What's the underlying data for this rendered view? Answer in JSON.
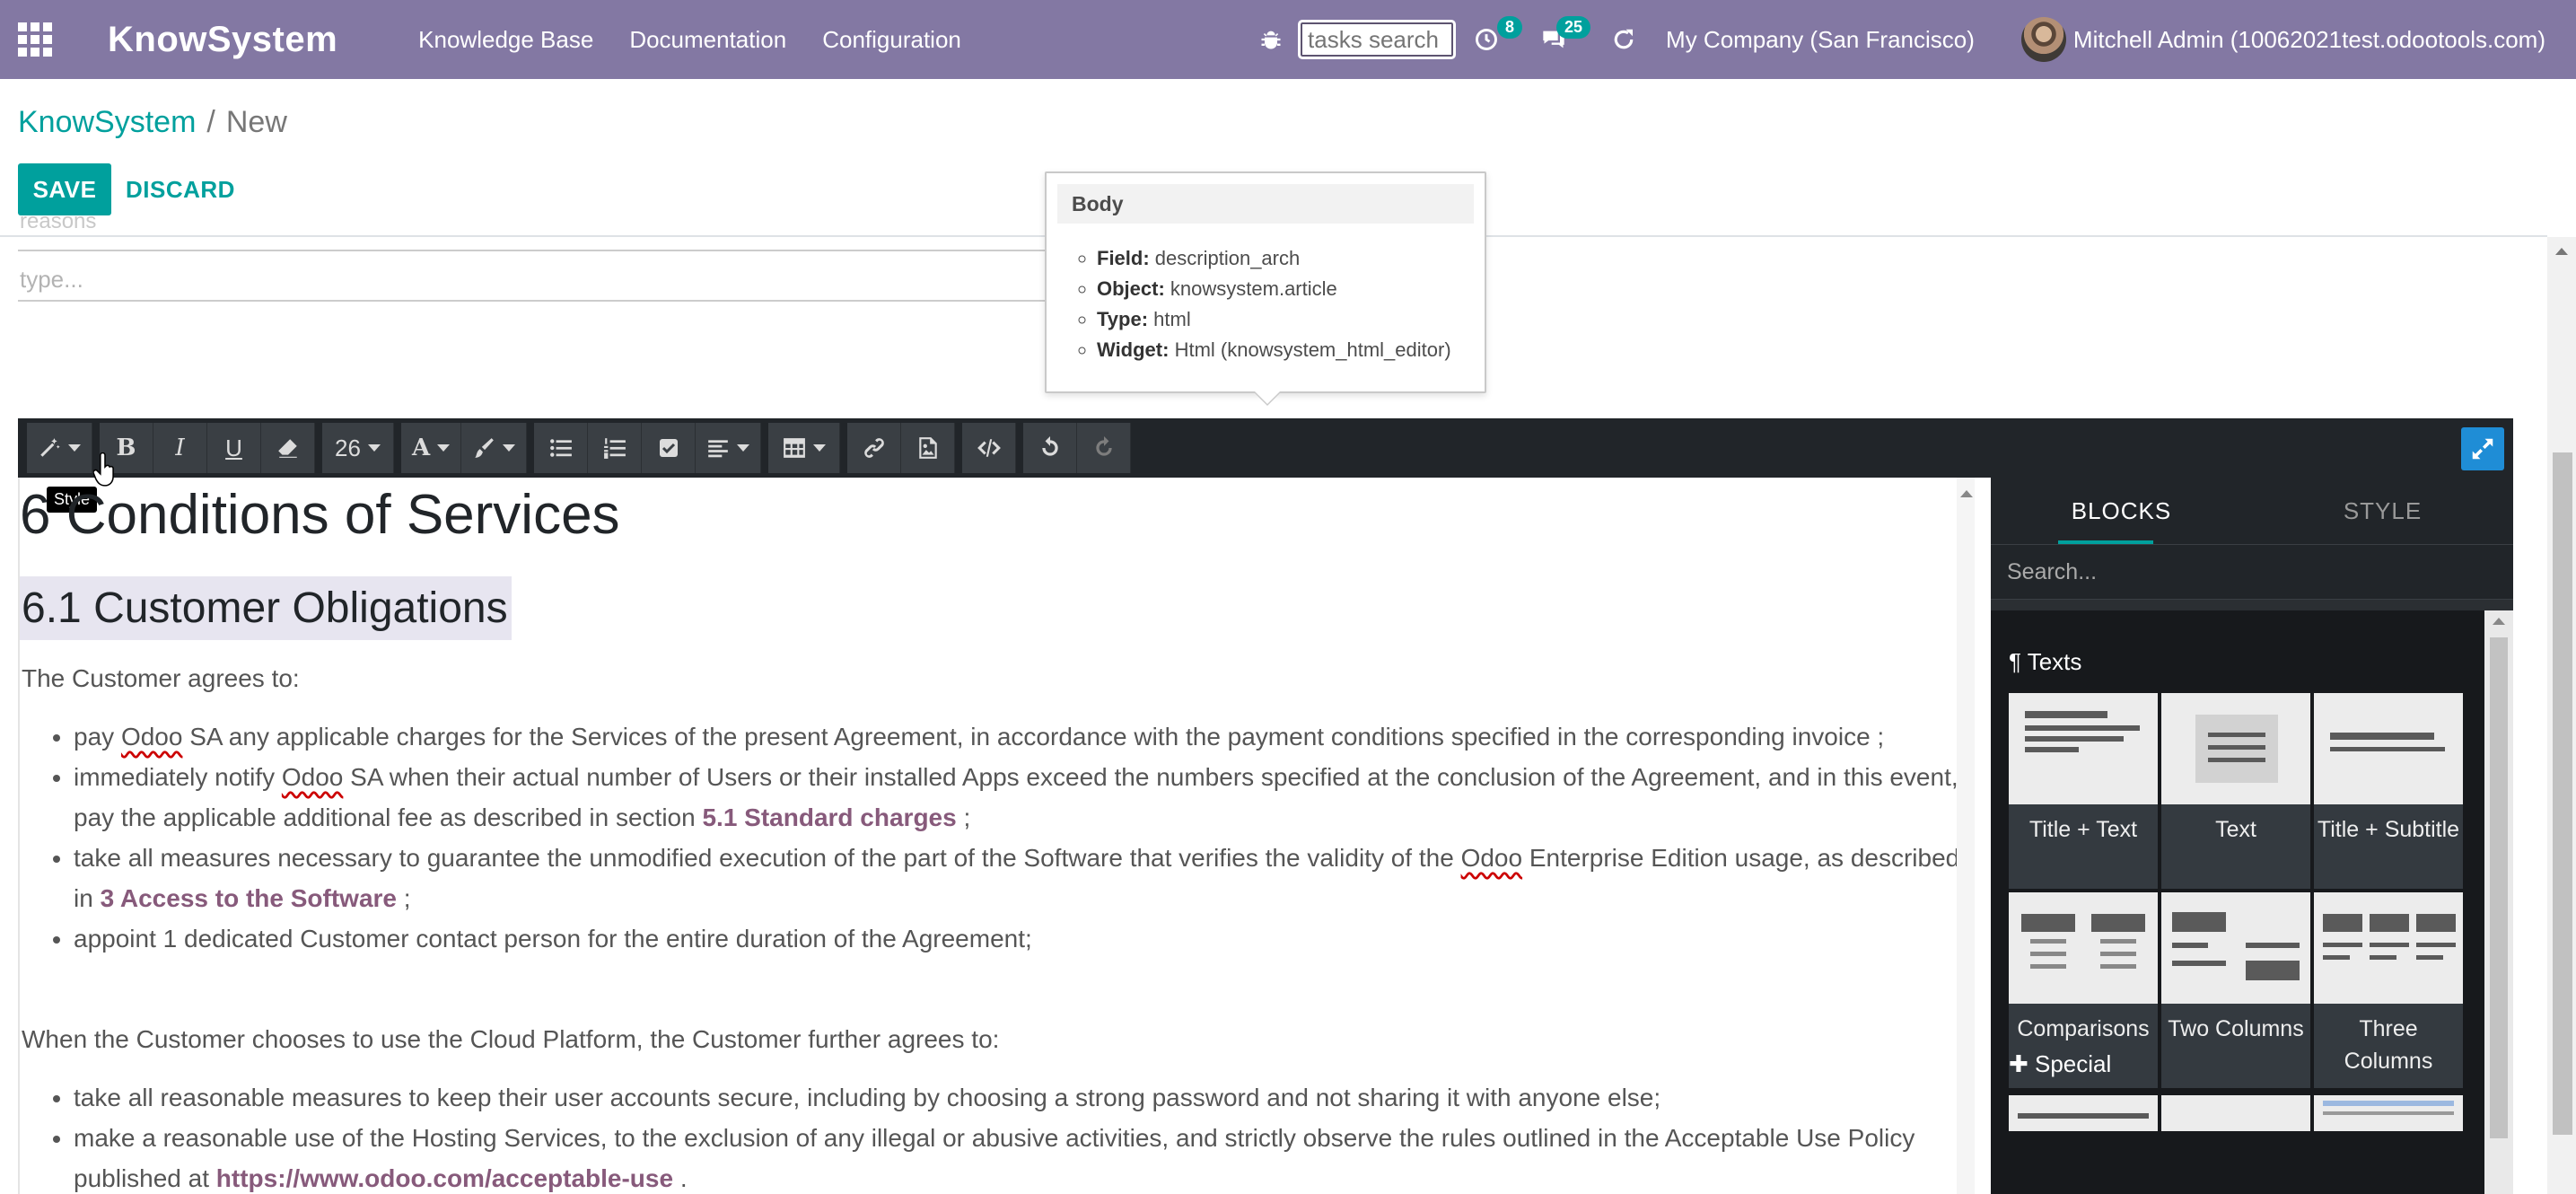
{
  "navbar": {
    "brand": "KnowSystem",
    "menu": [
      "Knowledge Base",
      "Documentation",
      "Configuration"
    ],
    "tasks_search_placeholder": "tasks search",
    "activity_count": "8",
    "messages_count": "25",
    "company": "My Company (San Francisco)",
    "user": "Mitchell Admin (10062021test.odootools.com)"
  },
  "breadcrumb": {
    "parent": "KnowSystem",
    "separator": "/",
    "current": "New"
  },
  "buttons": {
    "save": "SAVE",
    "discard": "DISCARD"
  },
  "form": {
    "ghost": "reasons",
    "type_placeholder": "type..."
  },
  "tooltip": {
    "title": "Body",
    "items": [
      {
        "key": "Field:",
        "value": "description_arch"
      },
      {
        "key": "Object:",
        "value": "knowsystem.article"
      },
      {
        "key": "Type:",
        "value": "html"
      },
      {
        "key": "Widget:",
        "value": "Html (knowsystem_html_editor)"
      }
    ]
  },
  "toolbar": {
    "font_size": "26",
    "style_tooltip": "Style"
  },
  "content": {
    "h1": "6 Conditions of Services",
    "h2": "6.1 Customer Obligations",
    "p1": "The Customer agrees to:",
    "li1_a": "pay ",
    "li1_odoo": "Odoo",
    "li1_b": " SA any applicable charges for the Services of the present Agreement, in accordance with the payment conditions specified in the corresponding invoice ;",
    "li2_a": "immediately notify ",
    "li2_odoo": "Odoo",
    "li2_b": " SA when their actual number of Users or their installed Apps exceed the numbers specified at the conclusion of the Agreement, and in this event, pay the applicable additional fee as described in section ",
    "li2_link": "5.1 Standard charges",
    "li2_c": " ;",
    "li3_a": "take all measures necessary to guarantee the unmodified execution of the part of the Software that verifies the validity of the ",
    "li3_odoo": "Odoo",
    "li3_b": " Enterprise Edition usage, as described in ",
    "li3_link": "3 Access to the Software",
    "li3_c": " ;",
    "li4": "appoint 1 dedicated Customer contact person for the entire duration of the Agreement;",
    "p2": "When the Customer chooses to use the Cloud Platform, the Customer further agrees to:",
    "li5": "take all reasonable measures to keep their user accounts secure, including by choosing a strong password and not sharing it with anyone else;",
    "li6_a": "make a reasonable use of the Hosting Services, to the exclusion of any illegal or abusive activities, and strictly observe the rules outlined in the Acceptable Use Policy published at ",
    "li6_link": "https://www.odoo.com/acceptable-use",
    "li6_b": " ."
  },
  "snippets": {
    "tabs": [
      "BLOCKS",
      "STYLE"
    ],
    "search_placeholder": "Search...",
    "cat_texts": "¶ Texts",
    "cat_special": "✚ Special",
    "blocks": [
      "Title + Text",
      "Text",
      "Title + Subtitle",
      "Comparisons",
      "Two Columns",
      "Three Columns"
    ]
  }
}
